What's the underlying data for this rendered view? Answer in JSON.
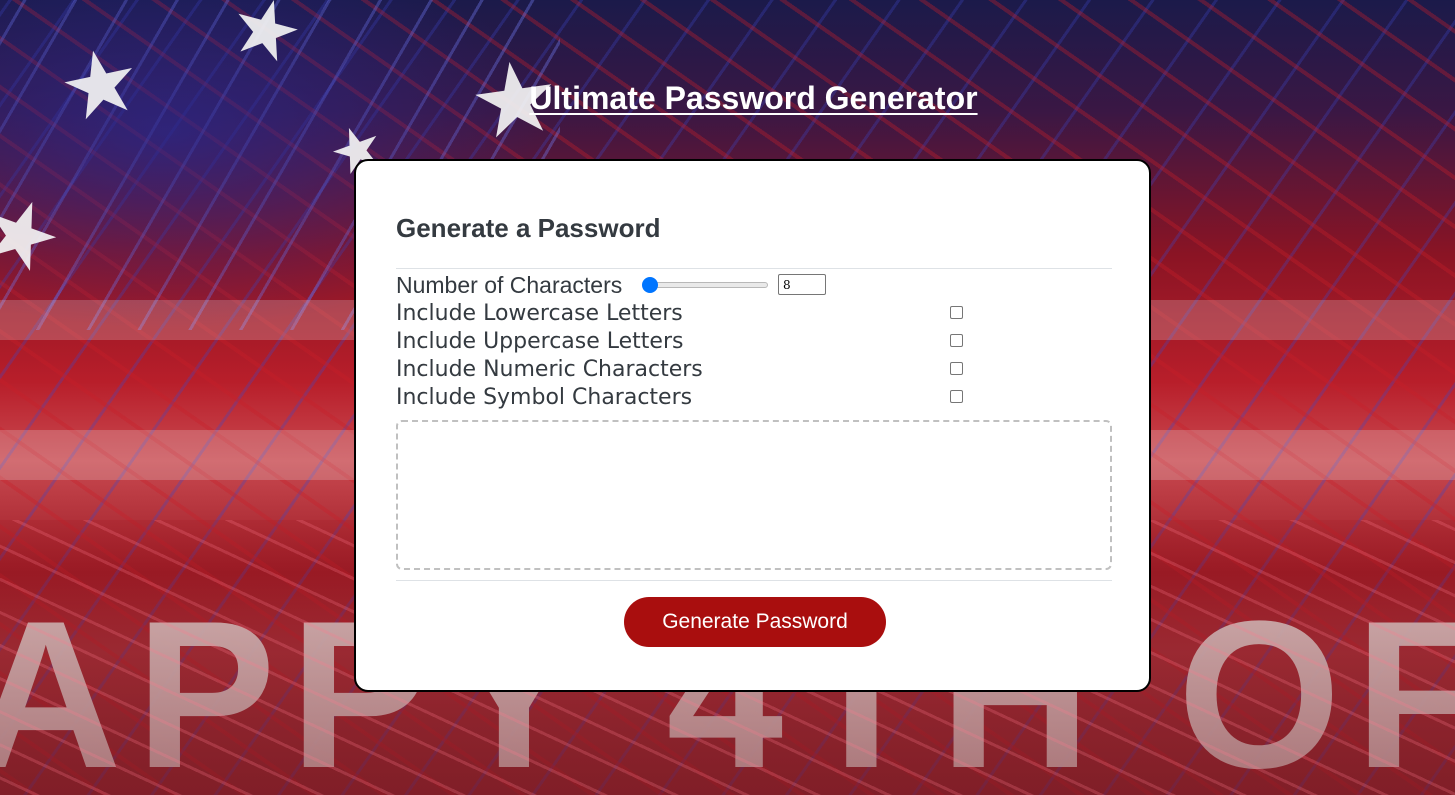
{
  "page": {
    "title": "Ultimate Password Generator"
  },
  "card": {
    "title": "Generate a Password",
    "length": {
      "label": "Number of Characters",
      "value": "8",
      "slider_fraction": 0.0
    },
    "options": [
      {
        "label": "Include Lowercase Letters",
        "checked": false
      },
      {
        "label": "Include Uppercase Letters",
        "checked": false
      },
      {
        "label": "Include Numeric Characters",
        "checked": false
      },
      {
        "label": "Include Symbol Characters",
        "checked": false
      }
    ],
    "password": {
      "value": "",
      "placeholder": ""
    },
    "generate_button": "Generate Password"
  },
  "colors": {
    "button_bg": "#a90e0e",
    "slider_accent": "#0075ff",
    "card_title": "#343a40"
  }
}
